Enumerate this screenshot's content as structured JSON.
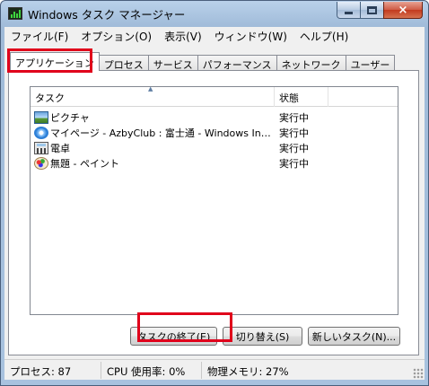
{
  "window": {
    "title": "Windows タスク マネージャー",
    "icon": "task-manager-icon",
    "caption_buttons": {
      "minimize": "minimize-icon",
      "maximize": "maximize-icon",
      "close": "×"
    }
  },
  "menubar": {
    "items": [
      "ファイル(F)",
      "オプション(O)",
      "表示(V)",
      "ウィンドウ(W)",
      "ヘルプ(H)"
    ]
  },
  "tabs": [
    {
      "label": "アプリケーション",
      "active": true
    },
    {
      "label": "プロセス"
    },
    {
      "label": "サービス"
    },
    {
      "label": "パフォーマンス"
    },
    {
      "label": "ネットワーク"
    },
    {
      "label": "ユーザー"
    }
  ],
  "task_list": {
    "columns": {
      "task": "タスク",
      "status": "状態",
      "sort_indicator": "▲"
    },
    "rows": [
      {
        "icon": "picture-icon",
        "task": "ピクチャ",
        "status": "実行中"
      },
      {
        "icon": "internet-explorer-icon",
        "task": "マイページ - AzbyClub : 富士通 - Windows Internet Explorer",
        "status": "実行中"
      },
      {
        "icon": "calculator-icon",
        "task": "電卓",
        "status": "実行中"
      },
      {
        "icon": "paint-icon",
        "task": "無題 - ペイント",
        "status": "実行中"
      }
    ]
  },
  "buttons": {
    "end_task": "タスクの終了(E)",
    "switch_to": "切り替え(S)",
    "new_task": "新しいタスク(N)..."
  },
  "statusbar": {
    "processes": "プロセス: 87",
    "cpu": "CPU 使用率: 0%",
    "memory": "物理メモリ: 27%"
  },
  "colors": {
    "highlight": "#e0001b",
    "title_gradient": "#b9d1ea",
    "close_button": "#c23a1e"
  }
}
